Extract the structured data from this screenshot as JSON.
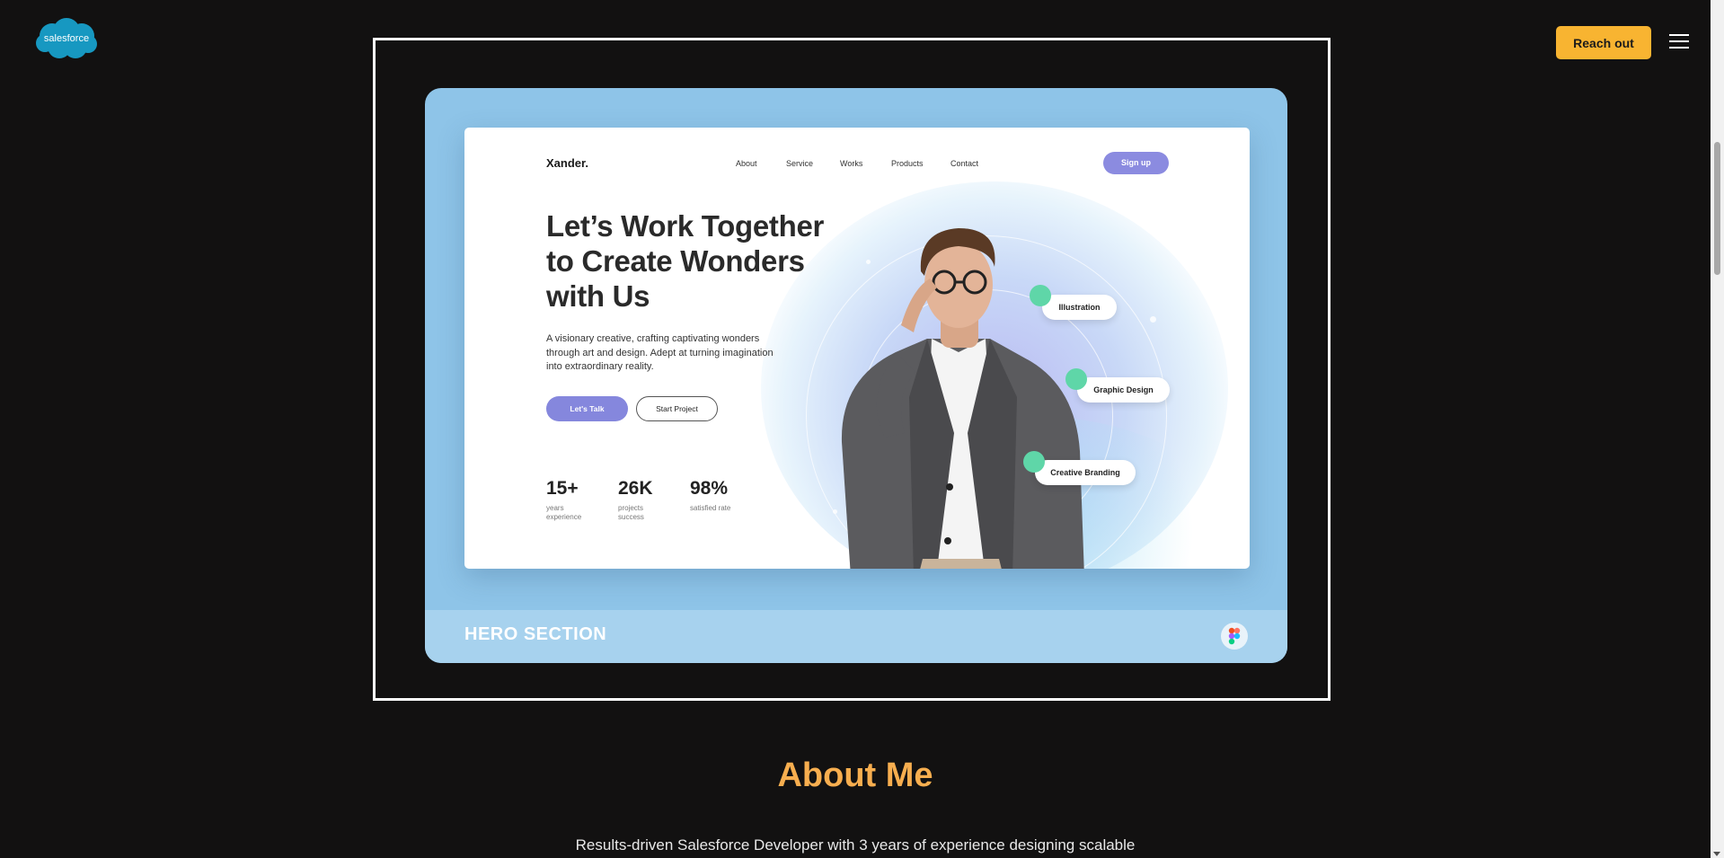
{
  "header": {
    "logo_text": "salesforce",
    "cta_label": "Reach out"
  },
  "showcase": {
    "footer_label": "HERO SECTION",
    "mockup": {
      "brand": "Xander.",
      "nav": [
        "About",
        "Service",
        "Works",
        "Products",
        "Contact"
      ],
      "signup_label": "Sign up",
      "headline": "Let’s Work Together to Create Wonders with Us",
      "description": "A visionary creative, crafting captivating wonders through art and design. Adept at turning imagination into extraordinary reality.",
      "primary_cta": "Let's Talk",
      "secondary_cta": "Start Project",
      "stats": [
        {
          "value": "15+",
          "label": "years experience"
        },
        {
          "value": "26K",
          "label": "projects success"
        },
        {
          "value": "98%",
          "label": "satisfied rate"
        }
      ],
      "tags": [
        "Illustration",
        "Graphic Design",
        "Creative Branding"
      ]
    }
  },
  "about": {
    "title": "About Me",
    "text": "Results-driven Salesforce Developer with 3 years of experience designing scalable"
  },
  "colors": {
    "background": "#121111",
    "accent": "#f8b431",
    "about_title": "#f7ae4f",
    "card": "#8ec4e8",
    "mock_primary": "#8587dd"
  }
}
